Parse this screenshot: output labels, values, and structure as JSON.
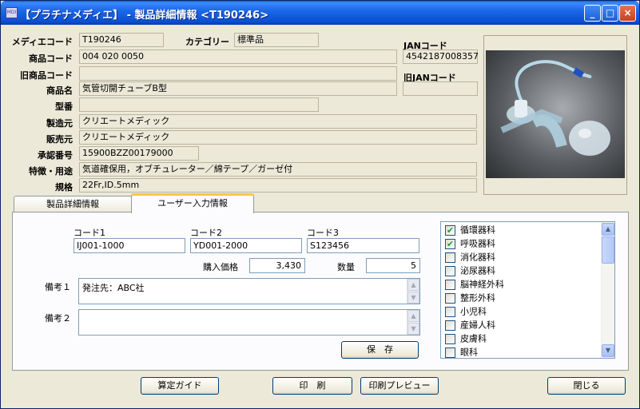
{
  "window": {
    "app_icon_text": "MDI",
    "title": "【プラチナメディエ】 - 製品詳細情報 <T190246>",
    "minimize": "_",
    "maximize": "□",
    "close": "×"
  },
  "details": {
    "medie_code_label": "メディエコード",
    "medie_code": "T190246",
    "category_label": "カテゴリー",
    "category": "標準品",
    "product_code_label": "商品コード",
    "product_code": "004 020 0050",
    "old_product_code_label": "旧商品コード",
    "old_product_code": "",
    "product_name_label": "商品名",
    "product_name": "気管切開チューブB型",
    "model_label": "型番",
    "model": "",
    "manufacturer_label": "製造元",
    "manufacturer": "クリエートメディック",
    "seller_label": "販売元",
    "seller": "クリエートメディック",
    "approval_label": "承認番号",
    "approval": "15900BZZ00179000",
    "feature_label": "特徴・用途",
    "feature": "気道確保用，オブチュレーター／綿テープ／ガーゼ付",
    "spec_label": "規格",
    "spec": "22Fr,ID.5mm",
    "jan_label": "JANコード",
    "jan": "4542187008357",
    "old_jan_label": "旧JANコード",
    "old_jan": ""
  },
  "tabs": [
    {
      "label": "製品詳細情報",
      "active": false
    },
    {
      "label": "ユーザー入力情報",
      "active": true
    }
  ],
  "user_input": {
    "code1_label": "コード1",
    "code1": "IJ001-1000",
    "code2_label": "コード2",
    "code2": "YD001-2000",
    "code3_label": "コード3",
    "code3": "S123456",
    "price_label": "購入価格",
    "price": "3,430",
    "qty_label": "数量",
    "qty": "5",
    "note1_label": "備考１",
    "note1": "発注先：ABC社",
    "note2_label": "備考２",
    "note2": "",
    "save_label": "保　存"
  },
  "departments": [
    {
      "label": "循環器科",
      "checked": true
    },
    {
      "label": "呼吸器科",
      "checked": true
    },
    {
      "label": "消化器科",
      "checked": false
    },
    {
      "label": "泌尿器科",
      "checked": false
    },
    {
      "label": "脳神経外科",
      "checked": false
    },
    {
      "label": "整形外科",
      "checked": false
    },
    {
      "label": "小児科",
      "checked": false
    },
    {
      "label": "産婦人科",
      "checked": false
    },
    {
      "label": "皮膚科",
      "checked": false
    },
    {
      "label": "眼科",
      "checked": false
    }
  ],
  "footer": {
    "calc_guide": "算定ガイド",
    "print": "印　刷",
    "print_preview": "印刷プレビュー",
    "close": "閉じる"
  },
  "icons": {
    "check_glyph": "✔",
    "up_arrow": "▲",
    "down_arrow": "▼"
  }
}
